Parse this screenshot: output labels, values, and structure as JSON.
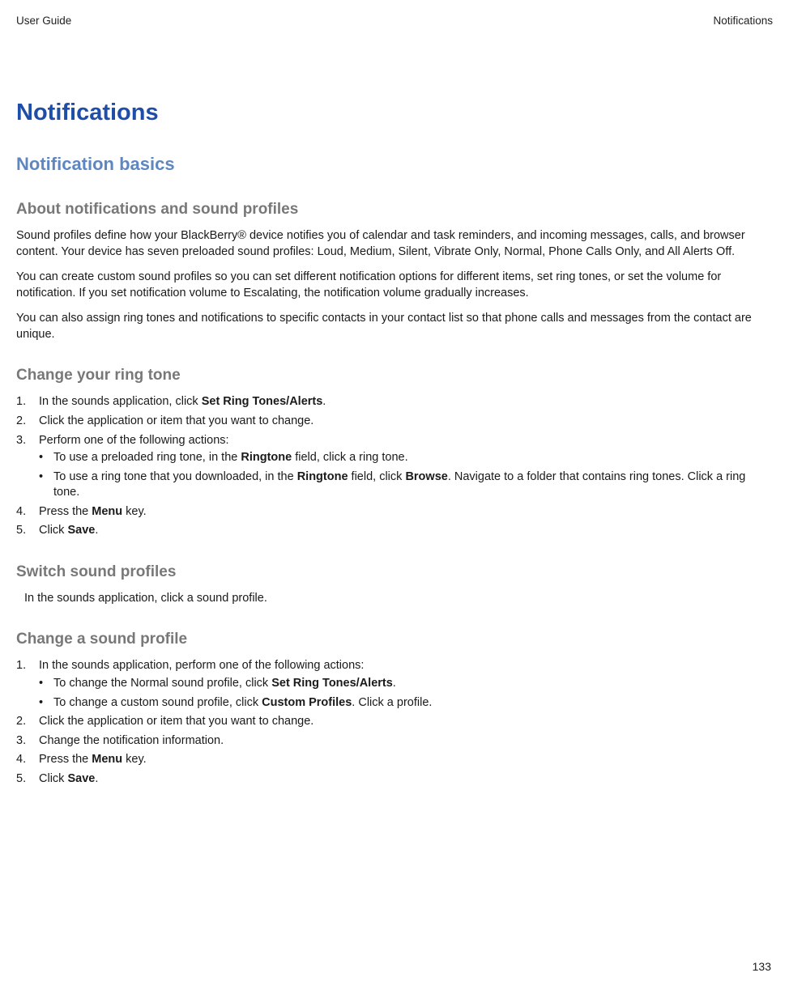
{
  "header": {
    "left": "User Guide",
    "right": "Notifications"
  },
  "chapter_title": "Notifications",
  "section_title": "Notification basics",
  "about": {
    "heading": "About notifications and sound profiles",
    "p1": "Sound profiles define how your BlackBerry® device notifies you of calendar and task reminders, and incoming messages, calls, and browser content. Your device has seven preloaded sound profiles: Loud, Medium, Silent, Vibrate Only, Normal, Phone Calls Only, and All Alerts Off.",
    "p2": "You can create custom sound profiles so you can set different notification options for different items, set ring tones, or set the volume for notification. If you set notification volume to Escalating, the notification volume gradually increases.",
    "p3": "You can also assign ring tones and notifications to specific contacts in your contact list so that phone calls and messages from the contact are unique."
  },
  "change_ring": {
    "heading": "Change your ring tone",
    "step1_pre": "In the sounds application, click ",
    "step1_bold": "Set Ring Tones/Alerts",
    "step1_post": ".",
    "step2": "Click the application or item that you want to change.",
    "step3": "Perform one of the following actions:",
    "bullet1_pre": "To use a preloaded ring tone, in the ",
    "bullet1_b1": "Ringtone",
    "bullet1_mid": " field, click a ring tone.",
    "bullet2_pre": "To use a ring tone that you downloaded, in the ",
    "bullet2_b1": "Ringtone",
    "bullet2_mid": " field, click ",
    "bullet2_b2": "Browse",
    "bullet2_post": ". Navigate to a folder that contains ring tones. Click a ring tone.",
    "step4_pre": "Press the ",
    "step4_bold": "Menu",
    "step4_post": " key.",
    "step5_pre": "Click ",
    "step5_bold": "Save",
    "step5_post": "."
  },
  "switch_profiles": {
    "heading": "Switch sound profiles",
    "body": "In the sounds application, click a sound profile."
  },
  "change_profile": {
    "heading": "Change a sound profile",
    "step1": "In the sounds application, perform one of the following actions:",
    "bullet1_pre": "To change the Normal sound profile, click ",
    "bullet1_bold": "Set Ring Tones/Alerts",
    "bullet1_post": ".",
    "bullet2_pre": "To change a custom sound profile, click ",
    "bullet2_bold": "Custom Profiles",
    "bullet2_post": ". Click a profile.",
    "step2": "Click the application or item that you want to change.",
    "step3": "Change the notification information.",
    "step4_pre": "Press the ",
    "step4_bold": "Menu",
    "step4_post": " key.",
    "step5_pre": "Click ",
    "step5_bold": "Save",
    "step5_post": "."
  },
  "page_number": "133"
}
